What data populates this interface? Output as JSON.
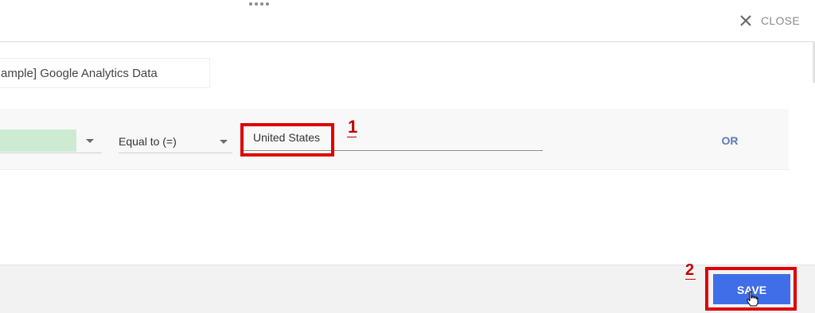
{
  "header": {
    "close_label": "CLOSE",
    "drag_icon": "drag-handle-dots-icon",
    "close_icon": "close-x-icon"
  },
  "form": {
    "name_value": "ample] Google Analytics Data"
  },
  "filter": {
    "operator_label": "Equal to (=)",
    "value": "United States",
    "or_label": "OR",
    "dimension_chip_color": "#cdebd3"
  },
  "footer": {
    "save_label": "SAVE",
    "save_color": "#3f6ee8"
  },
  "annotations": {
    "step_1": "1",
    "step_2": "2",
    "highlight_color": "#dd0000"
  }
}
